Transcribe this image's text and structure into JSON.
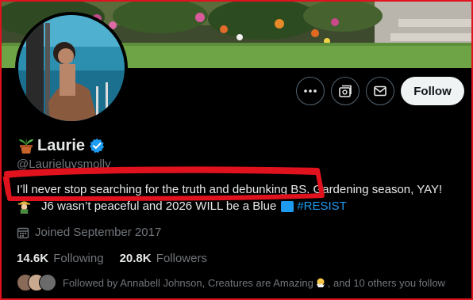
{
  "profile": {
    "display_name": "Laurie",
    "handle": "@Laurieluvsmolly",
    "bio_line1": "I’ll never stop searching for the truth and debunking BS. Gardening season, YAY!",
    "bio_line2_text": "J6 wasn’t peaceful and 2026 WILL be a Blue",
    "bio_hashtag": "#RESIST",
    "joined": "Joined September 2017",
    "following_count": "14.6K",
    "following_label": "Following",
    "followers_count": "20.8K",
    "followers_label": "Followers",
    "followed_by_prefix": "Followed by Annabell Johnson, Creatures are Amazing",
    "followed_by_suffix": ", and 10 others you follow"
  },
  "actions": {
    "more_icon": "more-icon",
    "subscribe_icon": "subscriptions-icon",
    "message_icon": "mail-icon",
    "follow_label": "Follow"
  },
  "colors": {
    "background": "#000000",
    "accent_blue": "#1d9bf0",
    "follow_button_bg": "#eff3f4",
    "secondary_text": "#71767b",
    "highlight_red": "#e0121d"
  }
}
